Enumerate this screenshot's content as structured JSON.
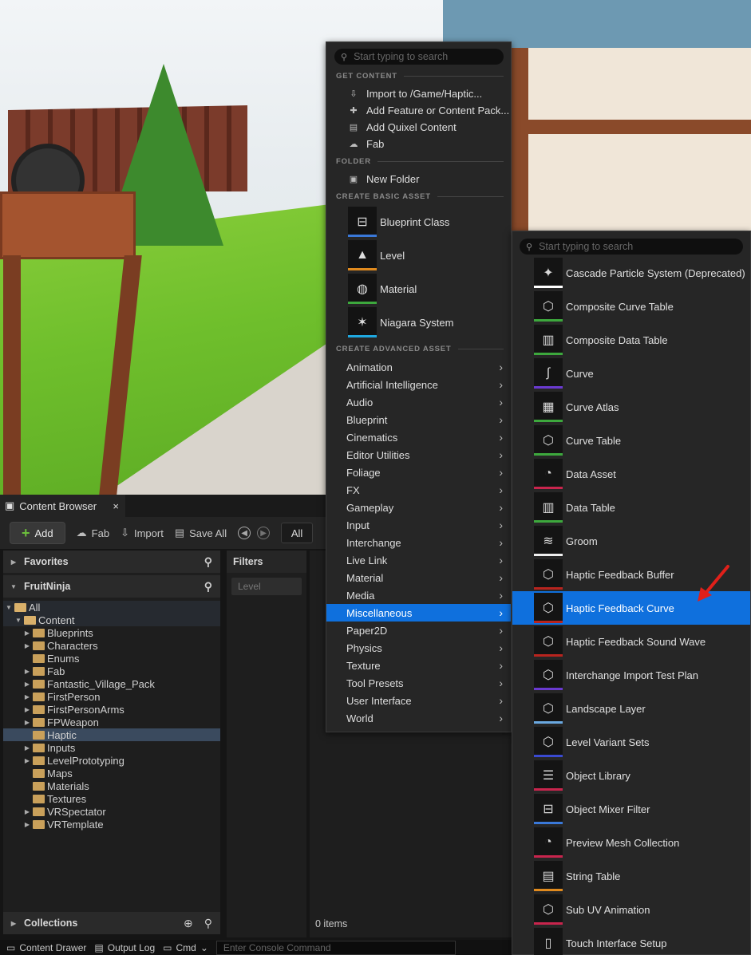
{
  "content_browser": {
    "tab_label": "Content Browser",
    "close_glyph": "×",
    "toolbar": {
      "add": "Add",
      "fab": "Fab",
      "import": "Import",
      "save_all": "Save All",
      "path": "All"
    },
    "favorites": "Favorites",
    "project": "FruitNinja",
    "tree": {
      "all": "All",
      "content": "Content",
      "folders": [
        "Blueprints",
        "Characters",
        "Enums",
        "Fab",
        "Fantastic_Village_Pack",
        "FirstPerson",
        "FirstPersonArms",
        "FPWeapon",
        "Haptic",
        "Inputs",
        "LevelPrototyping",
        "Maps",
        "Materials",
        "Textures",
        "VRSpectator",
        "VRTemplate"
      ]
    },
    "collections": "Collections",
    "filters": {
      "title": "Filters",
      "chip": "Level"
    },
    "items_count": "0 items"
  },
  "statusbar": {
    "content_drawer": "Content Drawer",
    "output_log": "Output Log",
    "cmd": "Cmd",
    "console_placeholder": "Enter Console Command"
  },
  "menu1": {
    "search_placeholder": "Start typing to search",
    "get_content": {
      "header": "GET CONTENT",
      "items": [
        "Import to /Game/Haptic...",
        "Add Feature or Content Pack...",
        "Add Quixel Content",
        "Fab"
      ]
    },
    "folder": {
      "header": "FOLDER",
      "items": [
        "New Folder"
      ]
    },
    "basic": {
      "header": "CREATE BASIC ASSET",
      "items": [
        {
          "label": "Blueprint Class",
          "color": "#3a78d8",
          "icon": "blueprint-icon"
        },
        {
          "label": "Level",
          "color": "#e08a1e",
          "icon": "level-icon"
        },
        {
          "label": "Material",
          "color": "#3da83d",
          "icon": "material-icon"
        },
        {
          "label": "Niagara System",
          "color": "#1fa8e0",
          "icon": "niagara-icon"
        }
      ]
    },
    "advanced": {
      "header": "CREATE ADVANCED ASSET",
      "items": [
        "Animation",
        "Artificial Intelligence",
        "Audio",
        "Blueprint",
        "Cinematics",
        "Editor Utilities",
        "Foliage",
        "FX",
        "Gameplay",
        "Input",
        "Interchange",
        "Live Link",
        "Material",
        "Media",
        "Miscellaneous",
        "Paper2D",
        "Physics",
        "Texture",
        "Tool Presets",
        "User Interface",
        "World"
      ],
      "active": "Miscellaneous"
    }
  },
  "menu2": {
    "search_placeholder": "Start typing to search",
    "items": [
      {
        "label": "Cascade Particle System (Deprecated)",
        "color": "#ffffff",
        "icon": "particle-icon"
      },
      {
        "label": "Composite Curve Table",
        "color": "#3da83d",
        "icon": "cube-icon"
      },
      {
        "label": "Composite Data Table",
        "color": "#3da83d",
        "icon": "bars-icon"
      },
      {
        "label": "Curve",
        "color": "#6a3ad0",
        "icon": "curve-icon"
      },
      {
        "label": "Curve Atlas",
        "color": "#3da83d",
        "icon": "checker-icon"
      },
      {
        "label": "Curve Table",
        "color": "#3da83d",
        "icon": "cube-icon"
      },
      {
        "label": "Data Asset",
        "color": "#c8254d",
        "icon": "pie-icon"
      },
      {
        "label": "Data Table",
        "color": "#3da83d",
        "icon": "bars-icon"
      },
      {
        "label": "Groom",
        "color": "#eeeeee",
        "icon": "groom-icon"
      },
      {
        "label": "Haptic Feedback Buffer",
        "color": "#b8241e",
        "icon": "cube-icon"
      },
      {
        "label": "Haptic Feedback Curve",
        "color": "#b8241e",
        "icon": "cube-icon"
      },
      {
        "label": "Haptic Feedback Sound Wave",
        "color": "#b8241e",
        "icon": "cube-icon"
      },
      {
        "label": "Interchange Import Test Plan",
        "color": "#6a3ad0",
        "icon": "cube-icon"
      },
      {
        "label": "Landscape Layer",
        "color": "#6aa8e0",
        "icon": "cube-icon"
      },
      {
        "label": "Level Variant Sets",
        "color": "#3a4ad0",
        "icon": "cube-icon"
      },
      {
        "label": "Object Library",
        "color": "#c8254d",
        "icon": "layers-icon"
      },
      {
        "label": "Object Mixer Filter",
        "color": "#3a78d8",
        "icon": "blueprint-icon"
      },
      {
        "label": "Preview Mesh Collection",
        "color": "#c8254d",
        "icon": "pie-icon"
      },
      {
        "label": "String Table",
        "color": "#e08a1e",
        "icon": "doc-icon"
      },
      {
        "label": "Sub UV Animation",
        "color": "#c8254d",
        "icon": "cube-icon"
      },
      {
        "label": "Touch Interface Setup",
        "color": "#c8254d",
        "icon": "phone-icon"
      }
    ],
    "active": "Haptic Feedback Curve"
  },
  "colors": {
    "highlight": "#0f70dd",
    "annotation_arrow": "#e0201a"
  }
}
